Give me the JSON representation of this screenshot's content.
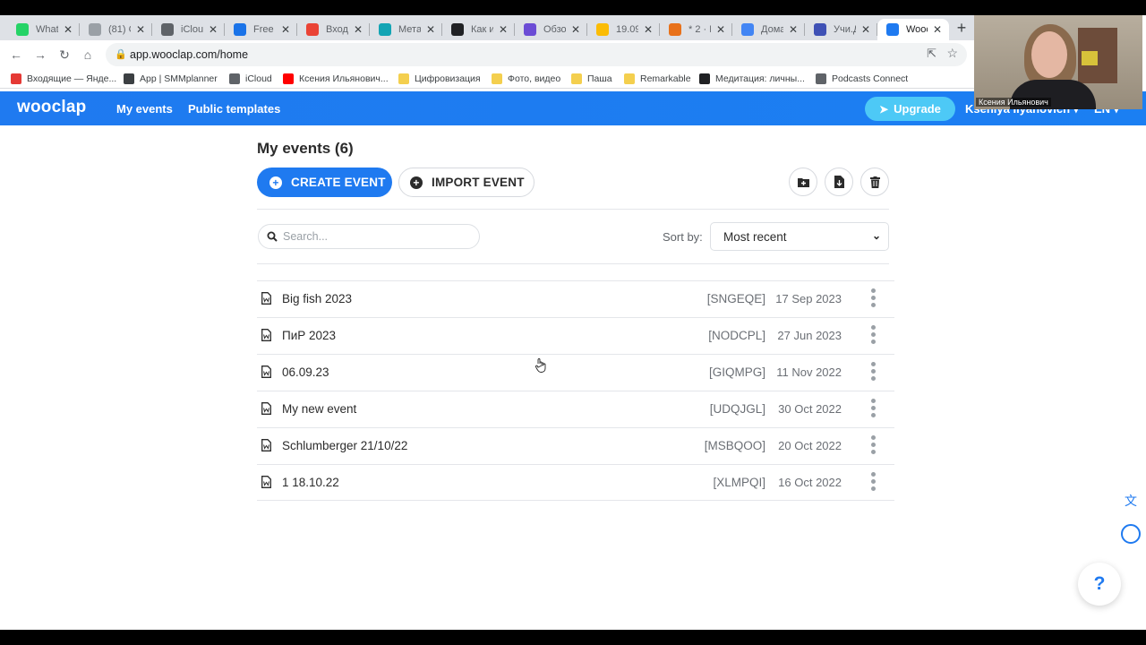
{
  "browser": {
    "tabs": [
      {
        "label": "Whats",
        "color": "#25d366",
        "icon": "whatsapp-icon"
      },
      {
        "label": "(81) C",
        "color": "#9aa0a6",
        "icon": "loading-icon"
      },
      {
        "label": "iCloud",
        "color": "#5f6368",
        "icon": "apple-icon"
      },
      {
        "label": "Free n",
        "color": "#1a73e8",
        "icon": "gear-icon"
      },
      {
        "label": "Входя",
        "color": "#ea4335",
        "icon": "gmail-icon"
      },
      {
        "label": "Мета",
        "color": "#12a4b4",
        "icon": "meta-icon"
      },
      {
        "label": "Как и",
        "color": "#202124",
        "icon": "s-icon"
      },
      {
        "label": "Обзор",
        "color": "#6b4cd5",
        "icon": "s-purple-icon"
      },
      {
        "label": "19.09.",
        "color": "#fbbc05",
        "icon": "drive-icon"
      },
      {
        "label": "* 2 · В",
        "color": "#e8711a",
        "icon": "mail-icon"
      },
      {
        "label": "Дома",
        "color": "#4285f4",
        "icon": "docs-icon"
      },
      {
        "label": "Учи.Д",
        "color": "#3f51b5",
        "icon": "d-icon"
      },
      {
        "label": "Wooc",
        "color": "#1f7af0",
        "icon": "wooclap-icon"
      }
    ],
    "url": "app.wooclap.com/home",
    "bookmarks": [
      {
        "label": "Входящие — Яндe...",
        "color": "#e53935"
      },
      {
        "label": "App | SMMplanner",
        "color": "#3c4043"
      },
      {
        "label": "iCloud",
        "color": "#5f6368"
      },
      {
        "label": "Ксения Ильянович...",
        "color": "#ff0000"
      },
      {
        "label": "Цифровизация",
        "color": "#f4cf4e"
      },
      {
        "label": "Фото, видео",
        "color": "#f4cf4e"
      },
      {
        "label": "Паша",
        "color": "#f4cf4e"
      },
      {
        "label": "Remarkable",
        "color": "#f4cf4e"
      },
      {
        "label": "Медитация: личны...",
        "color": "#202124"
      },
      {
        "label": "Podcasts Connect",
        "color": "#5f6368"
      }
    ]
  },
  "header": {
    "logo": "wooclap",
    "nav": [
      "My events",
      "Public templates"
    ],
    "upgrade_label": "Upgrade",
    "user_name": "Kseniya Ilyanovich ▾",
    "language": "EN ▾"
  },
  "webcam": {
    "name": "Ксения Ильянович"
  },
  "main": {
    "title": "My events (6)",
    "create_label": "CREATE EVENT",
    "import_label": "IMPORT EVENT",
    "search_placeholder": "Search...",
    "sort_label": "Sort by:",
    "sort_value": "Most recent",
    "events": [
      {
        "name": "Big fish 2023",
        "code": "[SNGEQE]",
        "date": "17 Sep 2023"
      },
      {
        "name": "ПиР 2023",
        "code": "[NODCPL]",
        "date": "27 Jun 2023"
      },
      {
        "name": "06.09.23",
        "code": "[GIQMPG]",
        "date": "11 Nov 2022"
      },
      {
        "name": "My new event",
        "code": "[UDQJGL]",
        "date": "30 Oct 2022"
      },
      {
        "name": "Schlumberger 21/10/22",
        "code": "[MSBQOO]",
        "date": "20 Oct 2022"
      },
      {
        "name": "1 18.10.22",
        "code": "[XLMPQI]",
        "date": "16 Oct 2022"
      }
    ]
  },
  "help_label": "?"
}
